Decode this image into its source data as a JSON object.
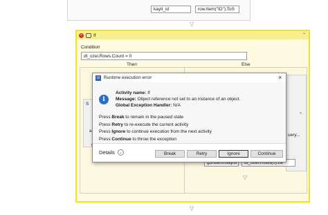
{
  "top_sequence": {
    "assign_left": "kayit_id",
    "assign_right": "row.Item(\"ID\").ToS"
  },
  "if_activity": {
    "title": "If",
    "condition_label": "Condition",
    "condition_value": "dt_ozel.Rows.Count = 0",
    "then_label": "Then",
    "else_label": "Else",
    "then_partial_text": "are",
    "then_partial_char": "g",
    "then_seq_letter": "S",
    "else_partial_text": "uery...",
    "else_assign_left": "gonderimsayisi",
    "else_assign_right": "dt_ozel.Rows(0).Ite"
  },
  "dialog": {
    "title": "Runtime execution error",
    "activity_name_label": "Activity name:",
    "activity_name_value": "If",
    "message_label": "Message:",
    "message_value": "Object reference not set to an instance of an object.",
    "handler_label": "Global Exception Handler:",
    "handler_value": "N/A",
    "instructions": [
      {
        "prefix": "Press ",
        "key": "Break",
        "suffix": " to remain in the paused state"
      },
      {
        "prefix": "Press ",
        "key": "Retry",
        "suffix": " to re-execute the current activity"
      },
      {
        "prefix": "Press ",
        "key": "Ignore",
        "suffix": " to continue execution from the next activity"
      },
      {
        "prefix": "Press ",
        "key": "Continue",
        "suffix": " to throw the exception"
      }
    ],
    "details_label": "Details",
    "buttons": {
      "break": "Break",
      "retry": "Retry",
      "ignore": "Ignore",
      "continue": "Continue"
    },
    "close_glyph": "×"
  },
  "icons": {
    "collapse": "⌃⌃",
    "chevron": "▽"
  },
  "colors": {
    "if_border": "#f4e416",
    "if_header": "#f6ef94",
    "info_blue": "#2d6fc7"
  }
}
